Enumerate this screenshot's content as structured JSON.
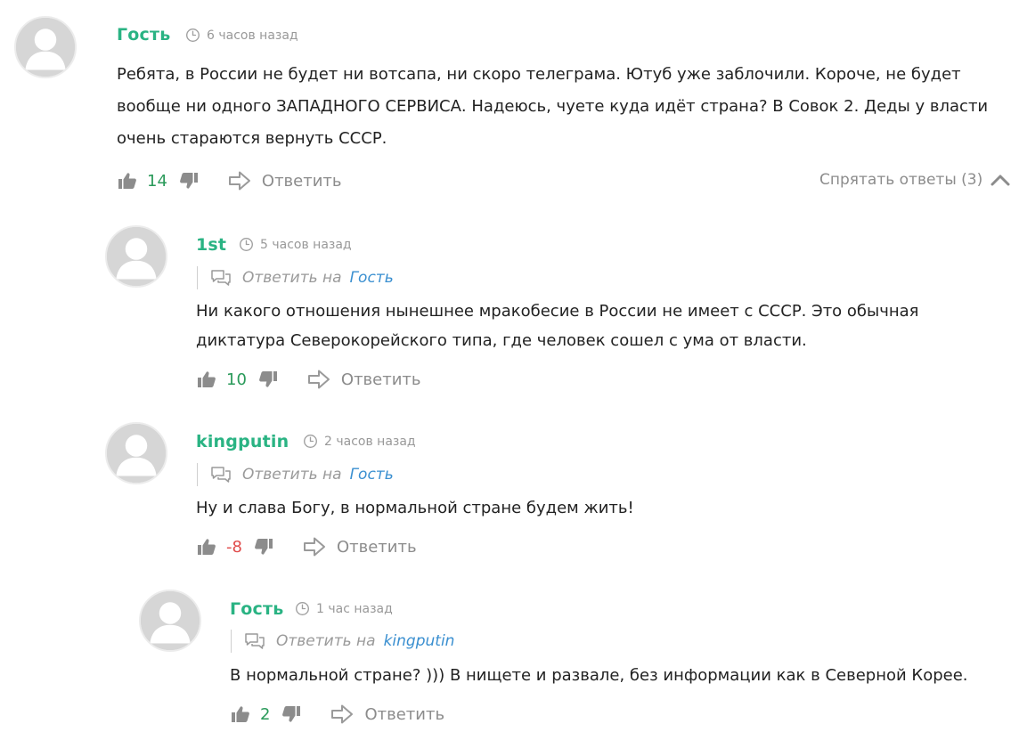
{
  "comments": [
    {
      "author": "Гость",
      "time": "6 часов назад",
      "text": "Ребята, в России не будет ни вотсапа, ни скоро телеграма. Ютуб уже заблочили. Короче, не будет вообще ни одного ЗАПАДНОГО СЕРВИСА. Надеюсь, чуете куда идёт страна? В Совок 2. Деды у власти очень стараются вернуть СССР.",
      "votes": "14",
      "reply_label": "Ответить"
    },
    {
      "author": "1st",
      "time": "5 часов назад",
      "reply_prefix": "Ответить на",
      "reply_target": "Гость",
      "text": "Ни какого отношения нынешнее мракобесие в России не имеет с СССР. Это обычная диктатура Северокорейского типа, где человек сошел с ума от власти.",
      "votes": "10",
      "reply_label": "Ответить"
    },
    {
      "author": "kingputin",
      "time": "2 часов назад",
      "reply_prefix": "Ответить на",
      "reply_target": "Гость",
      "text": "Ну и слава Богу, в нормальной стране будем жить!",
      "votes": "-8",
      "reply_label": "Ответить"
    },
    {
      "author": "Гость",
      "time": "1 час назад",
      "reply_prefix": "Ответить на",
      "reply_target": "kingputin",
      "text": "В нормальной стране? ))) В нищете и развале, без информации как в Северной Корее.",
      "votes": "2",
      "reply_label": "Ответить"
    }
  ],
  "toggle_replies": "Спрятать ответы (3)",
  "icons": {
    "avatar": "default-avatar-icon",
    "clock": "clock-icon",
    "like": "thumbs-up-icon",
    "dislike": "thumbs-down-icon",
    "reply": "reply-arrow-icon",
    "chat": "chat-bubbles-icon",
    "chevron": "chevron-up-icon"
  },
  "colors": {
    "author": "#2ab383",
    "link": "#3a8fd0",
    "positive": "#2a9a5a",
    "negative": "#e04b4b",
    "muted": "#8c8c8c"
  }
}
